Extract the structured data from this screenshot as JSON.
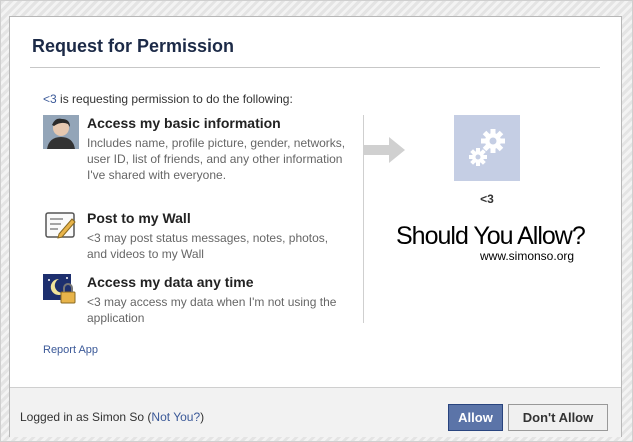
{
  "dialog": {
    "title": "Request for Permission",
    "intro_app": "<3",
    "intro_text": " is requesting permission to do the following:"
  },
  "permissions": [
    {
      "icon": "user-photo-icon",
      "title": "Access my basic information",
      "description": "Includes name, profile picture, gender, networks, user ID, list of friends, and any other information I've shared with everyone."
    },
    {
      "icon": "wall-post-icon",
      "title": "Post to my Wall",
      "description": "<3 may post status messages, notes, photos, and videos to my Wall"
    },
    {
      "icon": "offline-access-icon",
      "title": "Access my data any time",
      "description": "<3 may access my data when I'm not using the application"
    }
  ],
  "report_link": "Report App",
  "app": {
    "name": "<3",
    "tile_icon": "gears-icon",
    "tile_color": "#c5cee4"
  },
  "watermark": {
    "title": "Should You Allow?",
    "url": "www.simonso.org"
  },
  "footer": {
    "logged_in_prefix": "Logged in as Simon So (",
    "not_you_link": "Not You?",
    "logged_in_suffix": ")",
    "allow_label": "Allow",
    "deny_label": "Don't Allow"
  },
  "colors": {
    "link": "#3b5998",
    "allow_button": "#5b74a8",
    "title": "#1c2a47"
  }
}
